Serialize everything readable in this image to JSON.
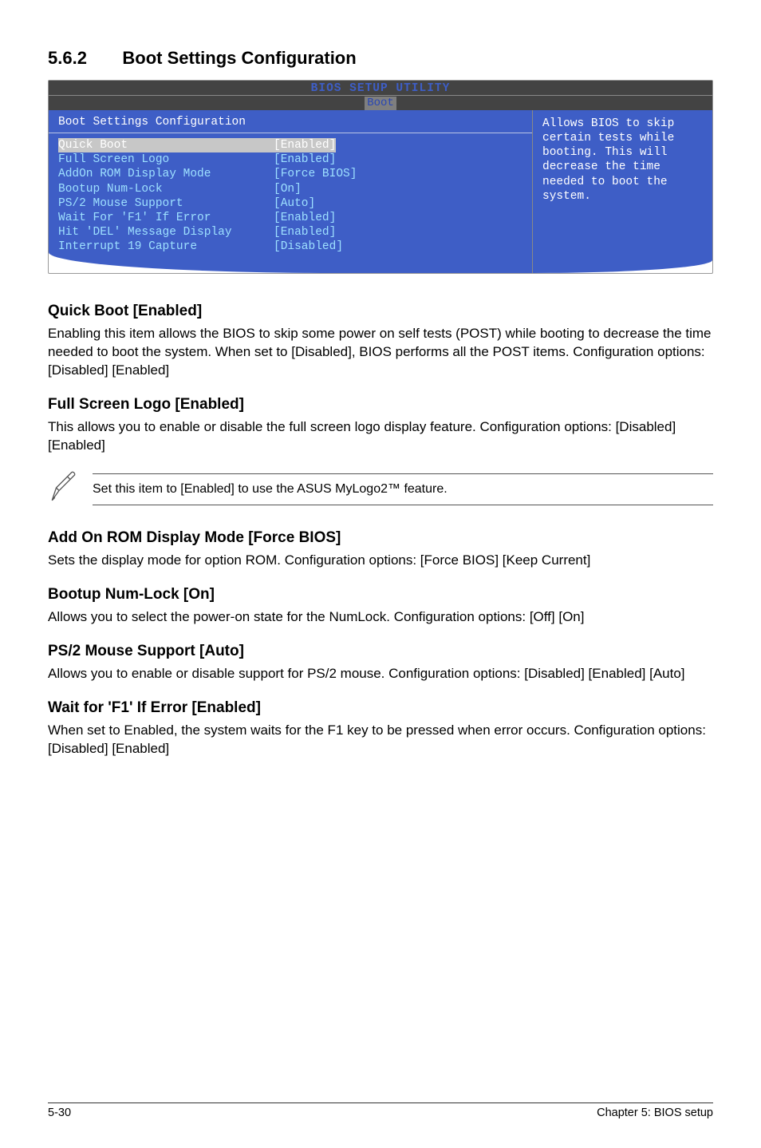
{
  "section": {
    "number": "5.6.2",
    "title": "Boot Settings Configuration"
  },
  "bios": {
    "header": "BIOS SETUP UTILITY",
    "tab": "Boot",
    "cfg_title": "Boot Settings Configuration",
    "rows": [
      {
        "label": "Quick Boot",
        "value": "[Enabled]",
        "selected": true
      },
      {
        "label": "Full Screen Logo",
        "value": "[Enabled]"
      },
      {
        "label": "AddOn ROM Display Mode",
        "value": "[Force BIOS]"
      },
      {
        "label": "Bootup Num-Lock",
        "value": "[On]"
      },
      {
        "label": "PS/2 Mouse Support",
        "value": "[Auto]"
      },
      {
        "label": "Wait For 'F1' If Error",
        "value": "[Enabled]"
      },
      {
        "label": "Hit 'DEL' Message Display",
        "value": "[Enabled]"
      },
      {
        "label": "Interrupt 19 Capture",
        "value": "[Disabled]"
      }
    ],
    "help": "Allows BIOS to skip certain tests while booting. This will decrease the time needed to boot the system."
  },
  "settings": {
    "quick_boot": {
      "title": "Quick Boot [Enabled]",
      "body": "Enabling this item allows the BIOS to skip some power on self tests (POST) while booting to decrease the time needed to boot the system. When set to [Disabled], BIOS performs all the POST items. Configuration options: [Disabled] [Enabled]"
    },
    "full_screen_logo": {
      "title": "Full Screen Logo [Enabled]",
      "body": "This allows you to enable or disable the full screen logo display feature. Configuration options: [Disabled] [Enabled]"
    },
    "note": {
      "text": "Set this item to [Enabled] to use the ASUS MyLogo2™ feature."
    },
    "addon_rom": {
      "title": "Add On ROM Display Mode [Force BIOS]",
      "body": "Sets the display mode for option ROM. Configuration options: [Force BIOS] [Keep Current]"
    },
    "bootup_numlock": {
      "title": "Bootup Num-Lock [On]",
      "body": "Allows you to select the power-on state for the NumLock. Configuration options: [Off] [On]"
    },
    "ps2_mouse": {
      "title": "PS/2 Mouse Support [Auto]",
      "body": "Allows you to enable or disable support for PS/2 mouse. Configuration options: [Disabled] [Enabled] [Auto]"
    },
    "wait_f1": {
      "title": "Wait for 'F1' If Error [Enabled]",
      "body": "When set to Enabled, the system waits for the F1 key to be pressed when error occurs. Configuration options: [Disabled] [Enabled]"
    }
  },
  "footer": {
    "left": "5-30",
    "right": "Chapter 5: BIOS setup"
  }
}
